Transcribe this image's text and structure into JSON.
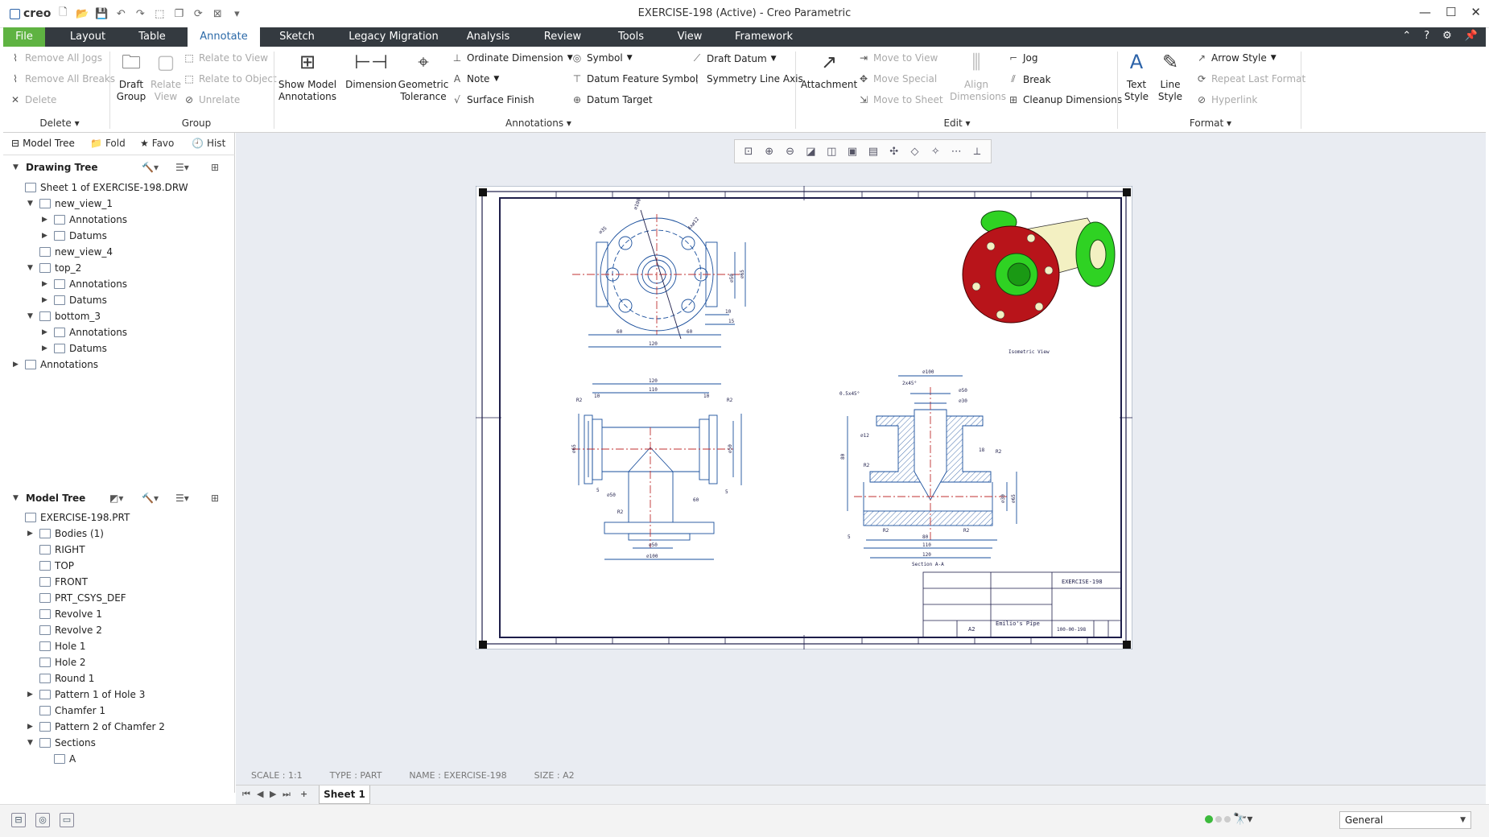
{
  "app": {
    "logo": "creo",
    "title": "EXERCISE-198 (Active) - Creo Parametric"
  },
  "tabs": [
    "File",
    "Layout",
    "Table",
    "Annotate",
    "Sketch",
    "Legacy Migration",
    "Analysis",
    "Review",
    "Tools",
    "View",
    "Framework"
  ],
  "active_tab": "Annotate",
  "ribbon": {
    "delete_group": {
      "remove_all_jogs": "Remove All Jogs",
      "remove_all_breaks": "Remove All Breaks",
      "delete": "Delete",
      "label": "Delete"
    },
    "group_group": {
      "draft_group": "Draft\nGroup",
      "relate_view": "Relate\nView",
      "relate_to_view": "Relate to View",
      "relate_to_object": "Relate to Object",
      "unrelate": "Unrelate",
      "label": "Group"
    },
    "annotations_group": {
      "show_model_annotations": "Show Model\nAnnotations",
      "dimension": "Dimension",
      "geometric_tolerance": "Geometric\nTolerance",
      "ordinate_dimension": "Ordinate Dimension",
      "note": "Note",
      "surface_finish": "Surface Finish",
      "symbol": "Symbol",
      "datum_feature_symbol": "Datum Feature Symbol",
      "datum_target": "Datum Target",
      "draft_datum": "Draft Datum",
      "symmetry_line_axis": "Symmetry Line Axis",
      "label": "Annotations"
    },
    "edit_group": {
      "attachment": "Attachment",
      "move_to_view": "Move to View",
      "move_special": "Move Special",
      "move_to_sheet": "Move to Sheet",
      "align_dimensions": "Align\nDimensions",
      "jog": "Jog",
      "break": "Break",
      "cleanup_dimensions": "Cleanup Dimensions",
      "label": "Edit"
    },
    "format_group": {
      "text_style": "Text\nStyle",
      "line_style": "Line\nStyle",
      "arrow_style": "Arrow Style",
      "repeat_last_format": "Repeat Last Format",
      "hyperlink": "Hyperlink",
      "label": "Format"
    }
  },
  "left_panel": {
    "tabs": [
      "Model Tree",
      "Fold",
      "Favo",
      "Hist"
    ],
    "drawing_tree": {
      "title": "Drawing Tree",
      "items": [
        {
          "label": "Sheet 1 of EXERCISE-198.DRW",
          "level": 0,
          "expand": ""
        },
        {
          "label": "new_view_1",
          "level": 1,
          "expand": "open"
        },
        {
          "label": "Annotations",
          "level": 2,
          "expand": "closed"
        },
        {
          "label": "Datums",
          "level": 2,
          "expand": "closed"
        },
        {
          "label": "new_view_4",
          "level": 1,
          "expand": ""
        },
        {
          "label": "top_2",
          "level": 1,
          "expand": "open"
        },
        {
          "label": "Annotations",
          "level": 2,
          "expand": "closed"
        },
        {
          "label": "Datums",
          "level": 2,
          "expand": "closed"
        },
        {
          "label": "bottom_3",
          "level": 1,
          "expand": "open"
        },
        {
          "label": "Annotations",
          "level": 2,
          "expand": "closed"
        },
        {
          "label": "Datums",
          "level": 2,
          "expand": "closed"
        },
        {
          "label": "Annotations",
          "level": 0,
          "expand": "closed"
        }
      ]
    },
    "model_tree": {
      "title": "Model Tree",
      "items": [
        {
          "label": "EXERCISE-198.PRT",
          "level": 0,
          "expand": ""
        },
        {
          "label": "Bodies (1)",
          "level": 1,
          "expand": "closed"
        },
        {
          "label": "RIGHT",
          "level": 1,
          "expand": ""
        },
        {
          "label": "TOP",
          "level": 1,
          "expand": ""
        },
        {
          "label": "FRONT",
          "level": 1,
          "expand": ""
        },
        {
          "label": "PRT_CSYS_DEF",
          "level": 1,
          "expand": ""
        },
        {
          "label": "Revolve 1",
          "level": 1,
          "expand": ""
        },
        {
          "label": "Revolve 2",
          "level": 1,
          "expand": ""
        },
        {
          "label": "Hole 1",
          "level": 1,
          "expand": ""
        },
        {
          "label": "Hole 2",
          "level": 1,
          "expand": ""
        },
        {
          "label": "Round 1",
          "level": 1,
          "expand": ""
        },
        {
          "label": "Pattern 1 of Hole 3",
          "level": 1,
          "expand": "closed"
        },
        {
          "label": "Chamfer 1",
          "level": 1,
          "expand": ""
        },
        {
          "label": "Pattern 2 of Chamfer 2",
          "level": 1,
          "expand": "closed"
        },
        {
          "label": "Sections",
          "level": 1,
          "expand": "open"
        },
        {
          "label": "A",
          "level": 2,
          "expand": ""
        }
      ]
    }
  },
  "drawing": {
    "status": [
      "SCALE : 1:1",
      "TYPE : PART",
      "NAME : EXERCISE-198",
      "SIZE : A2"
    ],
    "isometric_label": "Isometric View",
    "section_label": "Section A-A",
    "title_block": {
      "name": "EXERCISE-198",
      "part": "Emilio's Pipe",
      "size": "A2",
      "number": "100-00-198"
    },
    "dims_front": [
      "⌀100",
      "⌀35",
      "4xø12",
      "⌀50",
      "⌀65",
      "10",
      "15",
      "60",
      "60",
      "120"
    ],
    "dims_top": [
      "120",
      "110",
      "⌀65",
      "⌀50",
      "R2",
      "R2",
      "10",
      "10",
      "5",
      "5",
      "⌀50",
      "60",
      "R2",
      "⌀50",
      "⌀100"
    ],
    "dims_section": [
      "⌀100",
      "2x45°",
      "⌀50",
      "⌀30",
      "0.5x45°",
      "⌀12",
      "18",
      "R2",
      "R2",
      "80",
      "⌀30",
      "⌀65",
      "5",
      "80",
      "110",
      "120",
      "R2",
      "R2"
    ],
    "accent_green": "#27c51b",
    "accent_red": "#b8141a"
  },
  "sheet_tab": "Sheet 1",
  "status_bar": {
    "filter": "General"
  }
}
